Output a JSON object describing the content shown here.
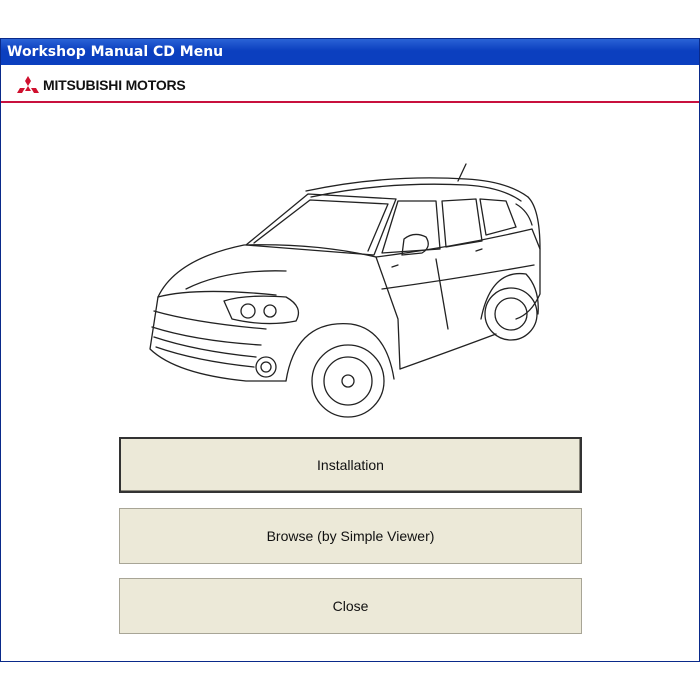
{
  "window": {
    "title": "Workshop Manual CD Menu"
  },
  "brand": {
    "name": "MITSUBISHI MOTORS",
    "logo_icon": "three-diamonds-logo-icon",
    "accent_color": "#c8103e"
  },
  "illustration": {
    "icon": "car-line-drawing-icon"
  },
  "buttons": {
    "installation": "Installation",
    "browse": "Browse (by Simple Viewer)",
    "close": "Close"
  },
  "colors": {
    "titlebar": "#0b3fbf",
    "button_face": "#ece9d8"
  }
}
